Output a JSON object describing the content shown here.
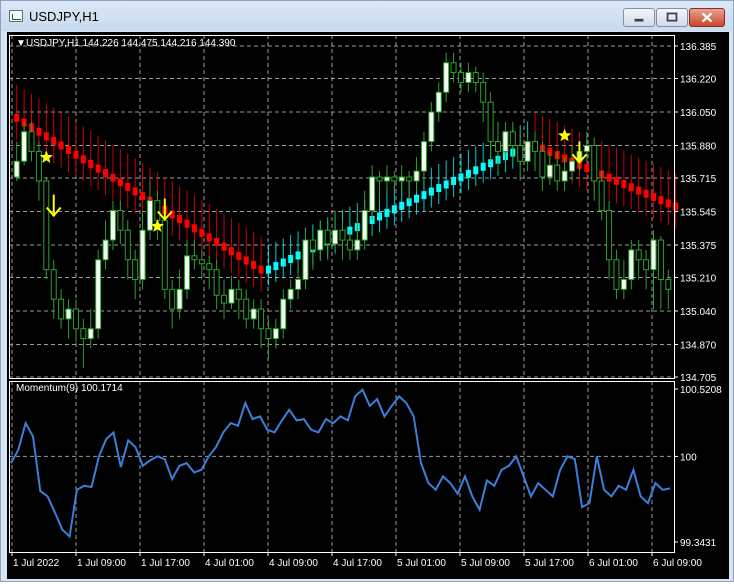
{
  "window": {
    "title": "USDJPY,H1",
    "icon": "chart-window-icon",
    "controls": {
      "minimize": "minimize-icon",
      "maximize": "maximize-icon",
      "close": "close-icon"
    }
  },
  "colors": {
    "background": "#000000",
    "grid": "#9a9a9a",
    "candle_up_body": "#f0fff0",
    "candle_down_body": "#000000",
    "candle_wick": "#2fa02f",
    "trend_down": "#ff0000",
    "trend_up": "#00ffff",
    "signal": "#ffff00",
    "momentum_line": "#3c7fd8",
    "text": "#ffffff"
  },
  "main_pane": {
    "header_arrow": "▼",
    "header_label": "USDJPY,H1  144.226 144.475 144.216 144.390",
    "price_labels": [
      "136.385",
      "136.220",
      "136.050",
      "135.880",
      "135.715",
      "135.545",
      "135.375",
      "135.210",
      "135.040",
      "134.870",
      "134.705"
    ]
  },
  "indicator_pane": {
    "label": "Momentum(9) 100.1714",
    "value_labels": [
      "100.5208",
      "100",
      "99.3431"
    ]
  },
  "time_axis": {
    "labels": [
      "1 Jul 2022",
      "1 Jul 09:00",
      "1 Jul 17:00",
      "4 Jul 01:00",
      "4 Jul 09:00",
      "4 Jul 17:00",
      "5 Jul 01:00",
      "5 Jul 09:00",
      "5 Jul 17:00",
      "6 Jul 01:00",
      "6 Jul 09:00"
    ]
  },
  "chart_data": {
    "type": "candlestick",
    "symbol": "USDJPY",
    "timeframe": "H1",
    "price_range": [
      134.705,
      136.385
    ],
    "candles": [
      [
        135.72,
        135.8,
        135.9,
        135.7
      ],
      [
        135.8,
        135.95,
        136.0,
        135.78
      ],
      [
        135.95,
        135.85,
        136.0,
        135.8
      ],
      [
        135.85,
        135.7,
        135.9,
        135.6
      ],
      [
        135.7,
        135.25,
        135.72,
        135.2
      ],
      [
        135.25,
        135.1,
        135.3,
        135.0
      ],
      [
        135.1,
        135.0,
        135.15,
        134.95
      ],
      [
        135.0,
        135.05,
        135.1,
        134.9
      ],
      [
        135.05,
        134.95,
        135.1,
        134.88
      ],
      [
        134.95,
        134.9,
        135.0,
        134.75
      ],
      [
        134.9,
        134.95,
        135.05,
        134.85
      ],
      [
        134.95,
        135.3,
        135.35,
        134.9
      ],
      [
        135.3,
        135.4,
        135.5,
        135.25
      ],
      [
        135.4,
        135.55,
        135.6,
        135.35
      ],
      [
        135.55,
        135.45,
        135.6,
        135.38
      ],
      [
        135.45,
        135.3,
        135.5,
        135.2
      ],
      [
        135.3,
        135.2,
        135.35,
        135.1
      ],
      [
        135.2,
        135.45,
        135.55,
        135.15
      ],
      [
        135.45,
        135.6,
        135.7,
        135.4
      ],
      [
        135.6,
        135.5,
        135.65,
        135.4
      ],
      [
        135.5,
        135.15,
        135.55,
        135.1
      ],
      [
        135.15,
        135.05,
        135.2,
        134.95
      ],
      [
        135.05,
        135.15,
        135.25,
        135.0
      ],
      [
        135.15,
        135.32,
        135.4,
        135.1
      ],
      [
        135.32,
        135.3,
        135.4,
        135.25
      ],
      [
        135.3,
        135.28,
        135.35,
        135.2
      ],
      [
        135.28,
        135.25,
        135.32,
        135.15
      ],
      [
        135.25,
        135.12,
        135.3,
        135.05
      ],
      [
        135.12,
        135.08,
        135.2,
        135.0
      ],
      [
        135.08,
        135.15,
        135.22,
        135.05
      ],
      [
        135.15,
        135.1,
        135.2,
        135.0
      ],
      [
        135.1,
        135.0,
        135.15,
        134.95
      ],
      [
        135.0,
        135.05,
        135.1,
        134.95
      ],
      [
        135.05,
        134.95,
        135.1,
        134.85
      ],
      [
        134.95,
        134.9,
        135.0,
        134.8
      ],
      [
        134.9,
        134.95,
        135.0,
        134.85
      ],
      [
        134.95,
        135.1,
        135.15,
        134.9
      ],
      [
        135.1,
        135.15,
        135.2,
        135.05
      ],
      [
        135.15,
        135.2,
        135.3,
        135.1
      ],
      [
        135.2,
        135.4,
        135.45,
        135.15
      ],
      [
        135.4,
        135.35,
        135.45,
        135.25
      ],
      [
        135.35,
        135.45,
        135.5,
        135.3
      ],
      [
        135.45,
        135.38,
        135.5,
        135.3
      ],
      [
        135.38,
        135.45,
        135.55,
        135.35
      ],
      [
        135.45,
        135.4,
        135.5,
        135.3
      ],
      [
        135.4,
        135.35,
        135.45,
        135.3
      ],
      [
        135.35,
        135.4,
        135.55,
        135.3
      ],
      [
        135.4,
        135.55,
        135.65,
        135.35
      ],
      [
        135.55,
        135.72,
        135.78,
        135.5
      ],
      [
        135.72,
        135.7,
        135.75,
        135.6
      ],
      [
        135.7,
        135.72,
        135.78,
        135.65
      ],
      [
        135.72,
        135.7,
        135.75,
        135.65
      ],
      [
        135.7,
        135.72,
        135.78,
        135.65
      ],
      [
        135.72,
        135.7,
        135.75,
        135.6
      ],
      [
        135.7,
        135.75,
        135.82,
        135.65
      ],
      [
        135.75,
        135.9,
        135.95,
        135.7
      ],
      [
        135.9,
        136.05,
        136.1,
        135.85
      ],
      [
        136.05,
        136.15,
        136.2,
        136.0
      ],
      [
        136.15,
        136.3,
        136.35,
        136.1
      ],
      [
        136.3,
        136.25,
        136.35,
        136.2
      ],
      [
        136.25,
        136.2,
        136.3,
        136.15
      ],
      [
        136.2,
        136.25,
        136.3,
        136.15
      ],
      [
        136.25,
        136.2,
        136.28,
        136.15
      ],
      [
        136.2,
        136.1,
        136.25,
        136.0
      ],
      [
        136.1,
        135.9,
        136.15,
        135.8
      ],
      [
        135.9,
        135.85,
        136.0,
        135.75
      ],
      [
        135.85,
        135.95,
        136.0,
        135.8
      ],
      [
        135.95,
        135.88,
        136.0,
        135.8
      ],
      [
        135.88,
        135.8,
        135.95,
        135.7
      ],
      [
        135.8,
        135.9,
        135.95,
        135.75
      ],
      [
        135.9,
        135.85,
        135.95,
        135.75
      ],
      [
        135.85,
        135.72,
        135.9,
        135.65
      ],
      [
        135.72,
        135.78,
        135.85,
        135.68
      ],
      [
        135.78,
        135.7,
        135.85,
        135.65
      ],
      [
        135.7,
        135.75,
        135.82,
        135.65
      ],
      [
        135.75,
        135.8,
        135.88,
        135.7
      ],
      [
        135.8,
        135.85,
        135.9,
        135.75
      ],
      [
        135.85,
        135.88,
        135.95,
        135.8
      ],
      [
        135.88,
        135.7,
        135.92,
        135.6
      ],
      [
        135.7,
        135.55,
        135.75,
        135.5
      ],
      [
        135.55,
        135.3,
        135.6,
        135.2
      ],
      [
        135.3,
        135.15,
        135.35,
        135.1
      ],
      [
        135.15,
        135.2,
        135.3,
        135.1
      ],
      [
        135.2,
        135.35,
        135.4,
        135.15
      ],
      [
        135.35,
        135.3,
        135.4,
        135.2
      ],
      [
        135.3,
        135.25,
        135.35,
        135.15
      ],
      [
        135.25,
        135.4,
        135.45,
        135.05
      ],
      [
        135.4,
        135.2,
        135.42,
        135.05
      ],
      [
        135.2,
        135.15,
        135.25,
        135.05
      ]
    ],
    "trend_line": {
      "segments": [
        {
          "trend": "down",
          "from_index": 0,
          "to_index": 33,
          "start": 136.02,
          "end": 135.25
        },
        {
          "trend": "up",
          "from_index": 34,
          "to_index": 69,
          "start": 135.25,
          "end": 135.88
        },
        {
          "trend": "down",
          "from_index": 70,
          "to_index": 89,
          "start": 135.88,
          "end": 135.57
        }
      ]
    },
    "signals": [
      {
        "index": 4,
        "type": "star",
        "price": 135.82
      },
      {
        "index": 5,
        "type": "arrow-down",
        "price": 135.57
      },
      {
        "index": 19,
        "type": "star",
        "price": 135.47
      },
      {
        "index": 20,
        "type": "arrow-down",
        "price": 135.55
      },
      {
        "index": 74,
        "type": "star",
        "price": 135.93
      },
      {
        "index": 76,
        "type": "arrow-down",
        "price": 135.84
      }
    ],
    "momentum": {
      "name": "Momentum(9)",
      "current": 100.1714,
      "range": [
        99.3431,
        100.5208
      ],
      "values": [
        99.95,
        100.05,
        100.25,
        100.15,
        99.74,
        99.7,
        99.58,
        99.45,
        99.4,
        99.75,
        99.78,
        99.77,
        100.0,
        100.13,
        100.18,
        99.92,
        100.12,
        100.07,
        99.93,
        99.97,
        100.0,
        99.98,
        99.83,
        99.93,
        99.95,
        99.88,
        99.9,
        100.0,
        100.07,
        100.18,
        100.25,
        100.23,
        100.4,
        100.28,
        100.3,
        100.2,
        100.18,
        100.27,
        100.35,
        100.27,
        100.28,
        100.2,
        100.18,
        100.28,
        100.25,
        100.3,
        100.27,
        100.45,
        100.5,
        100.38,
        100.43,
        100.3,
        100.38,
        100.45,
        100.4,
        100.3,
        99.95,
        99.8,
        99.75,
        99.85,
        99.8,
        99.72,
        99.85,
        99.7,
        99.6,
        99.82,
        99.78,
        99.9,
        99.93,
        100.0,
        99.85,
        99.7,
        99.8,
        99.75,
        99.7,
        99.9,
        100.0,
        99.98,
        99.62,
        99.65,
        100.0,
        99.75,
        99.7,
        99.78,
        99.75,
        99.9,
        99.7,
        99.65,
        99.8,
        99.75,
        99.76
      ]
    }
  }
}
